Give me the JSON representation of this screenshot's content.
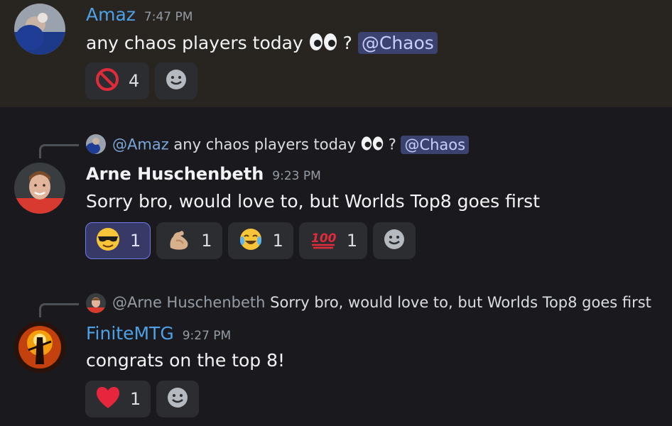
{
  "messages": [
    {
      "username": "Amaz",
      "timestamp": "7:47 PM",
      "text": "any chaos players today",
      "emoji": "eyes",
      "text_after": "?",
      "mention": "@Chaos",
      "reactions": [
        {
          "emoji": "no-entry",
          "count": "4"
        }
      ]
    },
    {
      "reply": {
        "username": "@Amaz",
        "text": "any chaos players today",
        "emoji": "eyes",
        "text_after": "?",
        "mention": "@Chaos"
      },
      "username": "Arne Huschenbeth",
      "timestamp": "9:23 PM",
      "text": "Sorry bro, would love to, but Worlds Top8 goes first",
      "reactions": [
        {
          "emoji": "sunglasses",
          "count": "1",
          "active": true
        },
        {
          "emoji": "flexed-biceps",
          "count": "1"
        },
        {
          "emoji": "joy",
          "count": "1"
        },
        {
          "emoji": "hundred",
          "count": "1"
        }
      ]
    },
    {
      "reply": {
        "username": "@Arne Huschenbeth",
        "text": "Sorry bro, would love to, but Worlds Top8 goes first"
      },
      "username": "FiniteMTG",
      "timestamp": "9:27 PM",
      "text": "congrats on the top 8!",
      "reactions": [
        {
          "emoji": "heart",
          "count": "1"
        }
      ]
    }
  ],
  "colors": {
    "accent_username": "#4ea1e6",
    "mention_bg": "#3c4270",
    "highlight_bg": "#28241f",
    "active_reaction_border": "#6f78e8"
  }
}
